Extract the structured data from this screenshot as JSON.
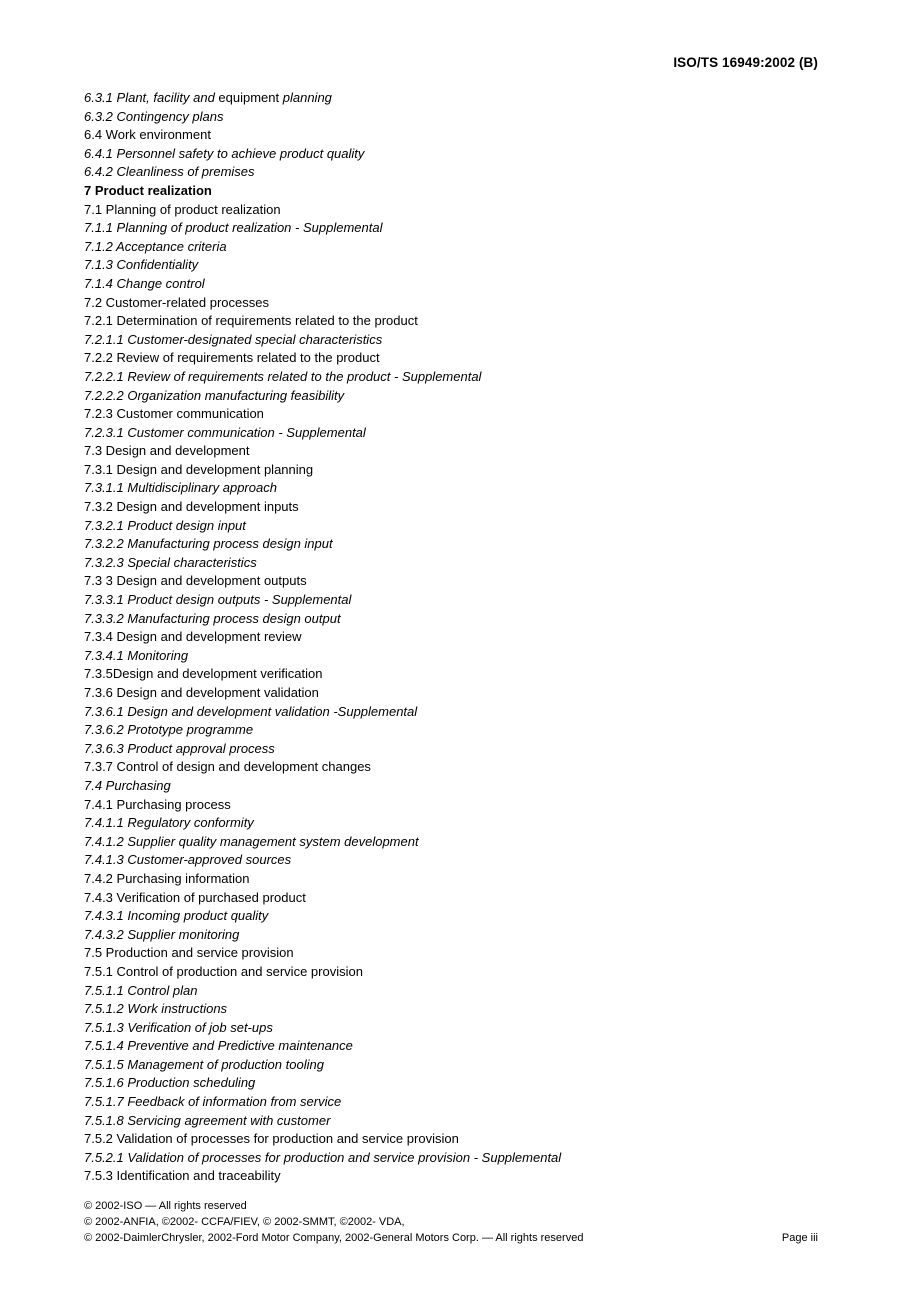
{
  "header": {
    "running_title": "ISO/TS 16949:2002 (B)"
  },
  "toc": {
    "entries": [
      {
        "text": "6.3.1 Plant, facility and equipment planning",
        "style": "mixed",
        "runs": [
          {
            "text": "6.3.1 Plant, facility and ",
            "style": "italic"
          },
          {
            "text": "equipment ",
            "style": "roman"
          },
          {
            "text": "planning",
            "style": "italic"
          }
        ]
      },
      {
        "text": "6.3.2 Contingency plans",
        "style": "italic"
      },
      {
        "text": "6.4 Work environment",
        "style": "roman"
      },
      {
        "text": "6.4.1 Personnel safety to achieve product quality",
        "style": "italic"
      },
      {
        "text": "6.4.2 Cleanliness of premises",
        "style": "italic"
      },
      {
        "text": "7 Product realization",
        "style": "bold"
      },
      {
        "text": "7.1 Planning of product realization",
        "style": "roman"
      },
      {
        "text": "7.1.1 Planning of product realization - Supplemental",
        "style": "italic"
      },
      {
        "text": "7.1.2 Acceptance criteria",
        "style": "italic"
      },
      {
        "text": "7.1.3 Confidentiality",
        "style": "italic"
      },
      {
        "text": "7.1.4 Change control",
        "style": "italic"
      },
      {
        "text": "7.2 Customer-related processes",
        "style": "roman"
      },
      {
        "text": "7.2.1 Determination of requirements related to the product",
        "style": "roman"
      },
      {
        "text": "7.2.1.1 Customer-designated special characteristics",
        "style": "italic"
      },
      {
        "text": "7.2.2 Review of requirements related to the product",
        "style": "roman"
      },
      {
        "text": "7.2.2.1 Review of requirements related to the product - Supplemental",
        "style": "italic"
      },
      {
        "text": "7.2.2.2 Organization manufacturing feasibility",
        "style": "italic"
      },
      {
        "text": "7.2.3 Customer communication",
        "style": "roman"
      },
      {
        "text": "7.2.3.1 Customer communication - Supplemental",
        "style": "italic"
      },
      {
        "text": "7.3 Design and development",
        "style": "roman"
      },
      {
        "text": "7.3.1 Design and development planning",
        "style": "roman"
      },
      {
        "text": "7.3.1.1 Multidisciplinary approach",
        "style": "italic"
      },
      {
        "text": "7.3.2 Design and development inputs",
        "style": "roman"
      },
      {
        "text": "7.3.2.1 Product design input",
        "style": "italic"
      },
      {
        "text": "7.3.2.2 Manufacturing process design input",
        "style": "italic"
      },
      {
        "text": "7.3.2.3 Special characteristics",
        "style": "italic"
      },
      {
        "text": "7.3 3 Design and development outputs",
        "style": "roman"
      },
      {
        "text": "7.3.3.1 Product design outputs - Supplemental",
        "style": "italic"
      },
      {
        "text": "7.3.3.2 Manufacturing process design output",
        "style": "italic"
      },
      {
        "text": "7.3.4 Design and development review",
        "style": "roman"
      },
      {
        "text": "7.3.4.1 Monitoring",
        "style": "italic"
      },
      {
        "text": "7.3.5Design and development verification",
        "style": "roman"
      },
      {
        "text": "7.3.6 Design and development validation",
        "style": "roman"
      },
      {
        "text": "7.3.6.1 Design and development validation -Supplemental",
        "style": "italic"
      },
      {
        "text": "7.3.6.2 Prototype programme",
        "style": "italic"
      },
      {
        "text": "7.3.6.3 Product approval process",
        "style": "italic"
      },
      {
        "text": "7.3.7 Control of design and development changes",
        "style": "roman"
      },
      {
        "text": "7.4 Purchasing",
        "style": "italic"
      },
      {
        "text": "7.4.1 Purchasing process",
        "style": "roman"
      },
      {
        "text": "7.4.1.1 Regulatory conformity",
        "style": "italic"
      },
      {
        "text": "7.4.1.2 Supplier quality management system development",
        "style": "italic"
      },
      {
        "text": "7.4.1.3 Customer-approved sources",
        "style": "italic"
      },
      {
        "text": "7.4.2 Purchasing information",
        "style": "roman"
      },
      {
        "text": "7.4.3 Verification of purchased product",
        "style": "roman"
      },
      {
        "text": "7.4.3.1 Incoming product quality",
        "style": "italic"
      },
      {
        "text": "7.4.3.2 Supplier monitoring",
        "style": "italic"
      },
      {
        "text": "7.5 Production and service provision",
        "style": "roman"
      },
      {
        "text": "7.5.1 Control of production and service provision",
        "style": "roman"
      },
      {
        "text": "7.5.1.1 Control plan",
        "style": "italic"
      },
      {
        "text": "7.5.1.2 Work instructions",
        "style": "italic"
      },
      {
        "text": "7.5.1.3 Verification of job set-ups",
        "style": "italic"
      },
      {
        "text": "7.5.1.4 Preventive and Predictive maintenance",
        "style": "italic"
      },
      {
        "text": "7.5.1.5 Management of production tooling",
        "style": "italic"
      },
      {
        "text": "7.5.1.6 Production scheduling",
        "style": "italic"
      },
      {
        "text": "7.5.1.7 Feedback of information from service",
        "style": "italic"
      },
      {
        "text": "7.5.1.8 Servicing agreement with customer",
        "style": "italic"
      },
      {
        "text": "7.5.2 Validation of processes for production and service provision",
        "style": "roman"
      },
      {
        "text": "7.5.2.1 Validation of processes for production and service provision - Supplemental",
        "style": "italic"
      },
      {
        "text": "7.5.3 Identification and traceability",
        "style": "roman"
      }
    ]
  },
  "footer": {
    "lines": [
      "© 2002-ISO  —  All rights reserved",
      "© 2002-ANFIA, ©2002- CCFA/FIEV, © 2002-SMMT, ©2002- VDA,",
      "© 2002-DaimlerChrysler, 2002-Ford Motor Company, 2002-General Motors Corp.  —  All rights reserved"
    ],
    "page_number": "Page iii"
  }
}
